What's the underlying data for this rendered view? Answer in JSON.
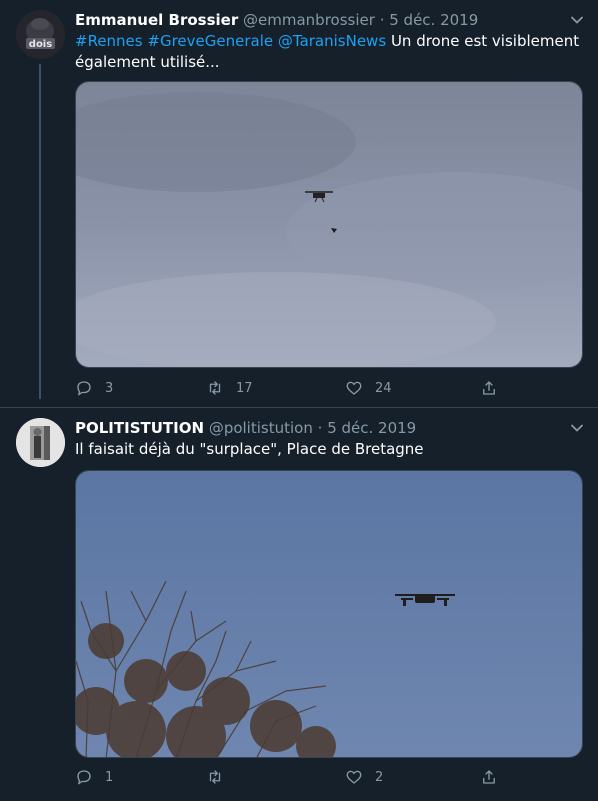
{
  "tweets": [
    {
      "author_name": "Emmanuel Brossier",
      "handle": "@emmanbrossier",
      "separator": "·",
      "date": "5 déc. 2019",
      "hashtag1": "#Rennes",
      "hashtag2": "#GreveGenerale",
      "mention": "@TaranisNews",
      "text": "Un drone est visiblement également utilisé...",
      "replies": "3",
      "retweets": "17",
      "likes": "24",
      "avatar_text": "dois"
    },
    {
      "author_name": "POLITISTUTION",
      "handle": "@politistution",
      "separator": "·",
      "date": "5 déc. 2019",
      "text": "Il faisait déjà du \"surplace\", Place de Bretagne",
      "replies": "1",
      "retweets": "",
      "likes": "2"
    }
  ],
  "colors": {
    "background": "#15202b",
    "link": "#1da1f2",
    "secondary_text": "#8899a6",
    "thread_line": "#3d5466"
  },
  "icons": [
    "chevron-down-icon",
    "reply-icon",
    "retweet-icon",
    "like-icon",
    "share-icon"
  ]
}
